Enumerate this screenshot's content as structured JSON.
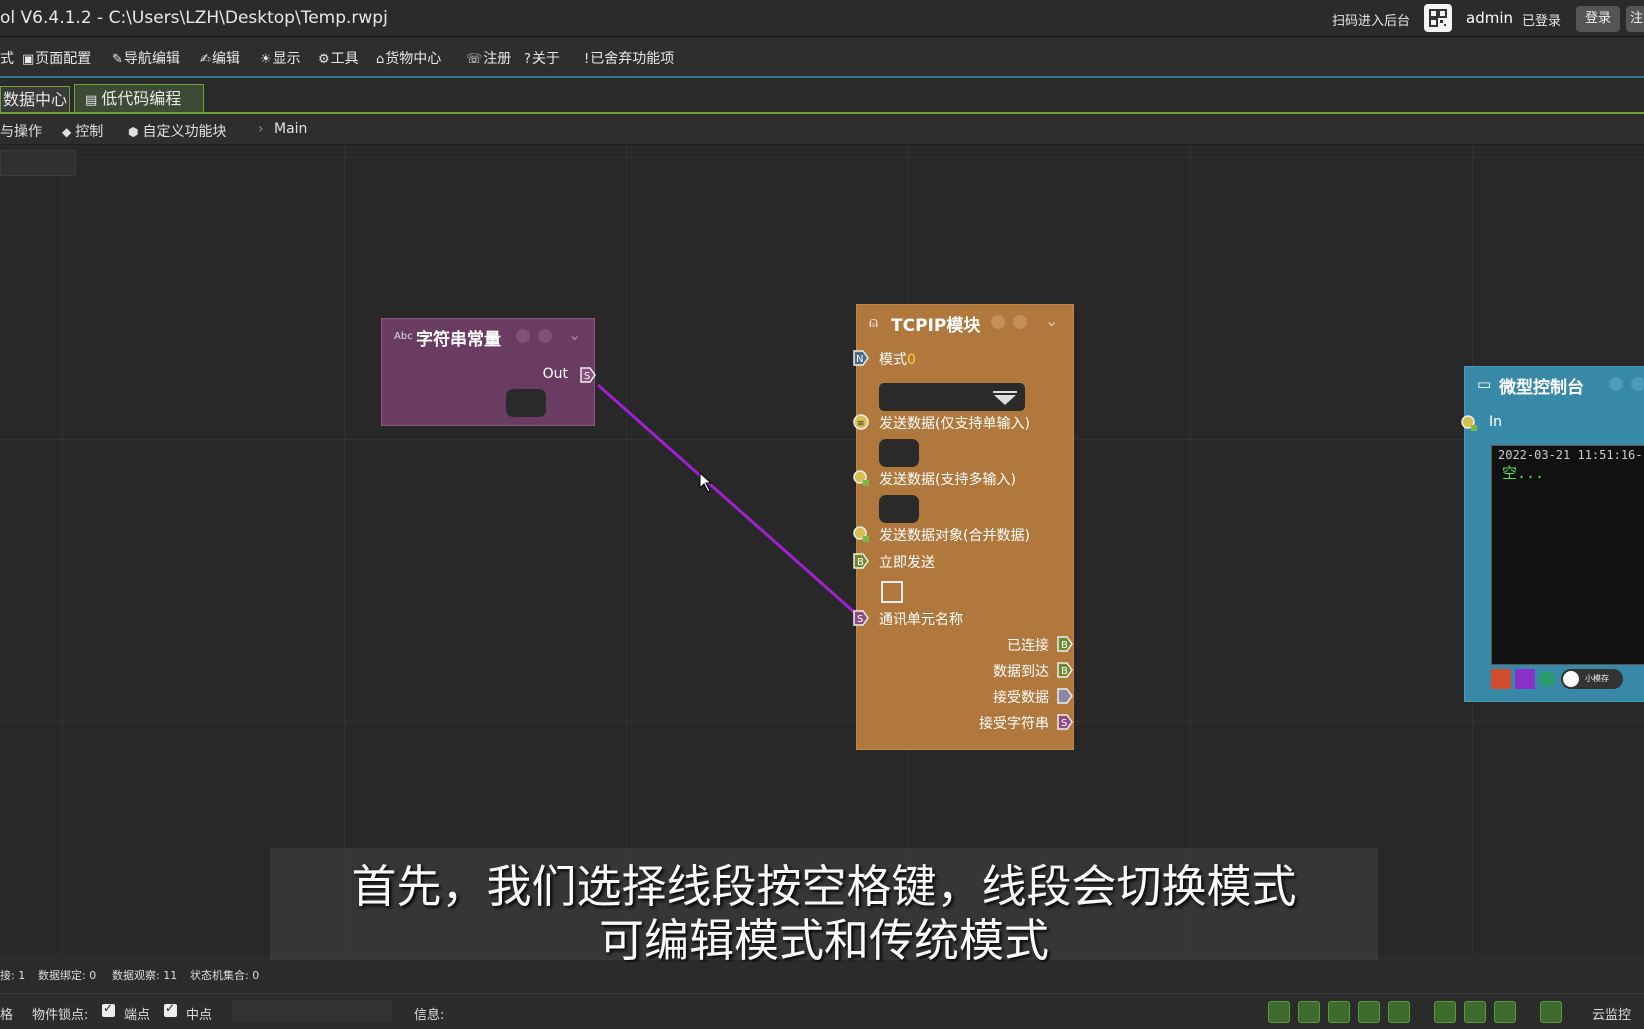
{
  "titlebar": {
    "app_title": "ol V6.4.1.2  -  C:\\Users\\LZH\\Desktop\\Temp.rwpj",
    "scan_text": "扫码进入后台",
    "user": "admin",
    "logged_in": "已登录",
    "login_button": "登录",
    "extra_button": "注"
  },
  "menu": {
    "items": [
      {
        "label": "式"
      },
      {
        "label": "页面配置"
      },
      {
        "label": "导航编辑"
      },
      {
        "label": "编辑"
      },
      {
        "label": "显示"
      },
      {
        "label": "工具"
      },
      {
        "label": "货物中心"
      },
      {
        "label": "注册"
      },
      {
        "label": "关于"
      },
      {
        "label": "已舍弃功能项"
      }
    ]
  },
  "tabs": [
    {
      "label": "数据中心"
    },
    {
      "label": "低代码编程"
    }
  ],
  "toolbar": {
    "items": [
      {
        "label": "与操作"
      },
      {
        "label": "控制"
      },
      {
        "label": "自定义功能块"
      }
    ],
    "breadcrumb": "Main"
  },
  "nodes": {
    "string_const": {
      "icon_text": "Abc",
      "title": "字符串常量",
      "out_label": "Out"
    },
    "tcpip": {
      "title": "TCPIP模块",
      "mode_label": "模式",
      "mode_value": "0",
      "inputs": [
        {
          "label": "发送数据(仅支持单输入)"
        },
        {
          "label": "发送数据(支持多输入)"
        },
        {
          "label": "发送数据对象(合并数据)"
        },
        {
          "label": "立即发送"
        },
        {
          "label": "通讯单元名称"
        }
      ],
      "outputs": [
        {
          "label": "已连接"
        },
        {
          "label": "数据到达"
        },
        {
          "label": "接受数据"
        },
        {
          "label": "接受字符串"
        }
      ]
    },
    "console": {
      "title": "微型控制台",
      "in_label": "In",
      "timestamp": "2022-03-21 11:51:16-",
      "empty_text": "空...",
      "toggle_label": "小模存"
    }
  },
  "subtitle": {
    "line1": "首先，我们选择线段按空格键，线段会切换模式",
    "line2": "可编辑模式和传统模式"
  },
  "status": {
    "items": [
      {
        "label": "接: 1"
      },
      {
        "label": "数据绑定: 0"
      },
      {
        "label": "数据观察: 11"
      },
      {
        "label": "状态机集合: 0"
      }
    ]
  },
  "bottombar": {
    "grid_label": "格",
    "lock_label": "物件锁点:",
    "endpoint_label": "端点",
    "midpoint_label": "中点",
    "info_label": "信息:",
    "cloud_label": "云监控"
  },
  "colors": {
    "string_node": "#6b3c61",
    "tcpip_node": "#b0783c",
    "console_node": "#3888a8",
    "wire": "#a020d0",
    "tab_accent": "#6da331"
  }
}
